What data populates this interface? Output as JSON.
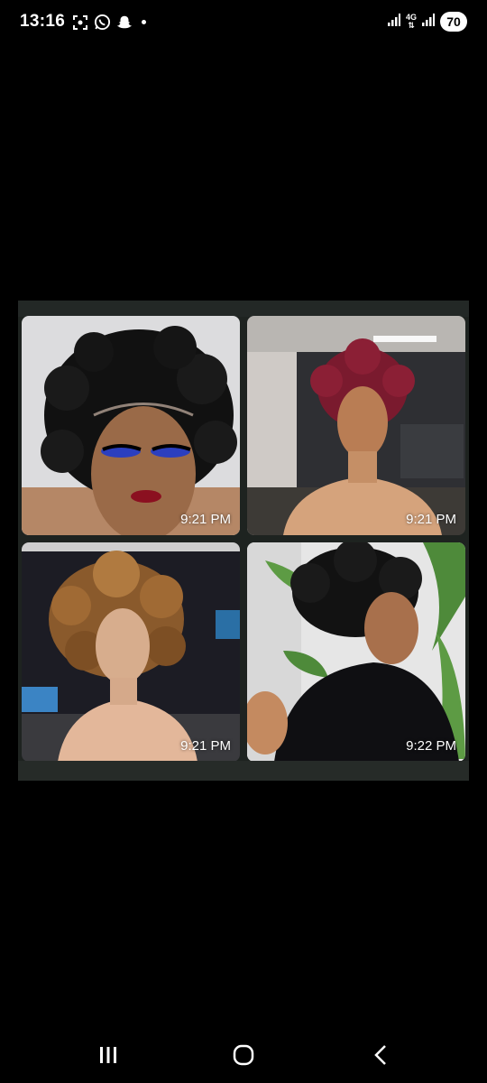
{
  "status_bar": {
    "time": "13:16",
    "left_icons": [
      "screenshot-icon",
      "whatsapp-icon",
      "snapchat-icon",
      "notification-dot"
    ],
    "network": "4G",
    "battery": "70"
  },
  "media": {
    "tiles": [
      {
        "id": "tile-1",
        "time": "9:21 PM",
        "subject": "black curly wig on model with blue eyeshadow"
      },
      {
        "id": "tile-2",
        "time": "9:21 PM",
        "subject": "burgundy curly wig on mannequin"
      },
      {
        "id": "tile-3",
        "time": "9:21 PM",
        "subject": "honey blonde curly wig on mannequin"
      },
      {
        "id": "tile-4",
        "time": "9:22 PM",
        "subject": "black pixie curly wig on mannequin",
        "is_video": true
      }
    ]
  },
  "nav_bar": {
    "buttons": [
      "recent-apps-icon",
      "home-icon",
      "back-icon"
    ]
  },
  "colors": {
    "background": "#000000",
    "frame": "#1e2320"
  }
}
